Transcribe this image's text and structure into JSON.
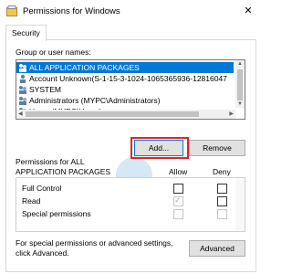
{
  "window": {
    "title": "Permissions for Windows"
  },
  "tabs": [
    {
      "label": "Security"
    }
  ],
  "groups": {
    "label": "Group or user names:",
    "items": [
      {
        "label": "ALL APPLICATION PACKAGES",
        "icon": "group-icon",
        "selected": true
      },
      {
        "label": "Account Unknown(S-1-15-3-1024-1065365936-12816047",
        "icon": "user-icon",
        "selected": false
      },
      {
        "label": "SYSTEM",
        "icon": "group-icon",
        "selected": false
      },
      {
        "label": "Administrators (MYPC\\Administrators)",
        "icon": "group-icon",
        "selected": false
      },
      {
        "label": "Users (MYPC\\Users)",
        "icon": "group-icon",
        "selected": false
      }
    ]
  },
  "buttons": {
    "add": "Add...",
    "remove": "Remove",
    "advanced": "Advanced"
  },
  "permissions": {
    "label_line1": "Permissions for ALL",
    "label_line2": "APPLICATION PACKAGES",
    "allow_header": "Allow",
    "deny_header": "Deny",
    "rows": [
      {
        "name": "Full Control",
        "allow": false,
        "allow_disabled": false,
        "deny": false
      },
      {
        "name": "Read",
        "allow": true,
        "allow_disabled": true,
        "deny": false
      },
      {
        "name": "Special permissions",
        "allow": false,
        "allow_disabled": true,
        "deny": false,
        "deny_disabled": true
      }
    ]
  },
  "footer": {
    "line1": "For special permissions or advanced settings,",
    "line2": "click Advanced."
  },
  "colors": {
    "selection": "#0078d7",
    "highlight": "#e0242a"
  }
}
